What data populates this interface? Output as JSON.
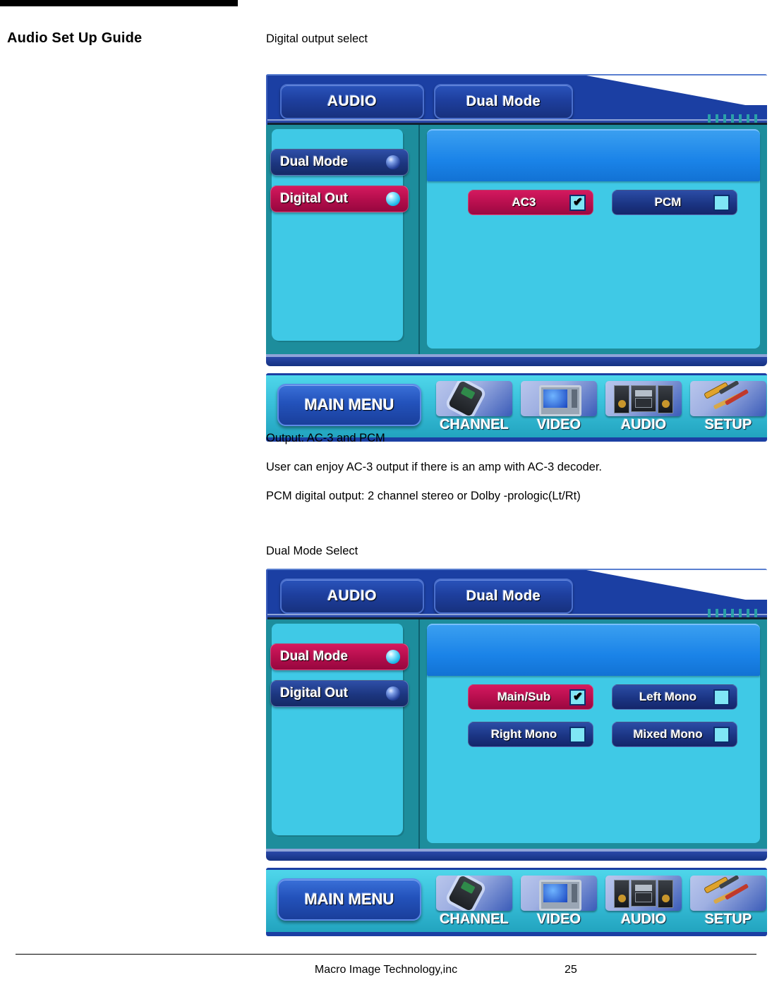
{
  "document": {
    "title": "Audio Set Up Guide",
    "footer_company": "Macro Image Technology,inc",
    "footer_page": "25"
  },
  "sections": [
    {
      "caption": "Digital output select",
      "notes": [
        "Output: AC-3 and PCM",
        "User can enjoy AC-3 output if there is an amp with AC-3 decoder.",
        "PCM digital output: 2 channel stereo or Dolby -prologic(Lt/Rt)"
      ]
    },
    {
      "caption": "Dual Mode Select",
      "notes": []
    }
  ],
  "osd1": {
    "tabs": {
      "left": "AUDIO",
      "right": "Dual Mode"
    },
    "menu": [
      {
        "label": "Dual Mode",
        "state": "inactive"
      },
      {
        "label": "Digital Out",
        "state": "active"
      }
    ],
    "options": [
      [
        {
          "label": "AC3",
          "checked": "✔",
          "style": "pink"
        },
        {
          "label": "PCM",
          "checked": "",
          "style": "navy"
        }
      ]
    ],
    "nav": {
      "main_menu": "MAIN MENU",
      "items": [
        {
          "label": "CHANNEL",
          "icon": "remote-control-icon"
        },
        {
          "label": "VIDEO",
          "icon": "tv-monitor-icon"
        },
        {
          "label": "AUDIO",
          "icon": "stereo-system-icon"
        },
        {
          "label": "SETUP",
          "icon": "tools-icon"
        }
      ]
    }
  },
  "osd2": {
    "tabs": {
      "left": "AUDIO",
      "right": "Dual Mode"
    },
    "menu": [
      {
        "label": "Dual Mode",
        "state": "active"
      },
      {
        "label": "Digital Out",
        "state": "inactive"
      }
    ],
    "options": [
      [
        {
          "label": "Main/Sub",
          "checked": "✔",
          "style": "pink"
        },
        {
          "label": "Left Mono",
          "checked": "",
          "style": "navy"
        }
      ],
      [
        {
          "label": "Right Mono",
          "checked": "",
          "style": "navy"
        },
        {
          "label": "Mixed Mono",
          "checked": "",
          "style": "navy"
        }
      ]
    ],
    "nav": {
      "main_menu": "MAIN MENU",
      "items": [
        {
          "label": "CHANNEL",
          "icon": "remote-control-icon"
        },
        {
          "label": "VIDEO",
          "icon": "tv-monitor-icon"
        },
        {
          "label": "AUDIO",
          "icon": "stereo-system-icon"
        },
        {
          "label": "SETUP",
          "icon": "tools-icon"
        }
      ]
    }
  },
  "colors": {
    "header_blue": "#1b3fa3",
    "panel_cyan": "#3fc9e6",
    "panel_teal": "#1d8d9c",
    "accent_pink": "#d4195f",
    "accent_navy": "#1b3584",
    "accent_orange": "#f0a458",
    "strip_blue": "#1a83e8"
  }
}
